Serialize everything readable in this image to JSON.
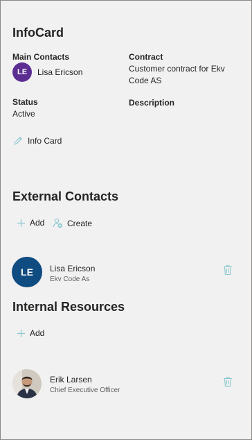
{
  "infocard": {
    "title": "InfoCard",
    "main_contacts_label": "Main Contacts",
    "main_contact": {
      "initials": "LE",
      "name": "Lisa Ericson"
    },
    "contract_label": "Contract",
    "contract_value": "Customer contract for Ekv Code AS",
    "status_label": "Status",
    "status_value": "Active",
    "description_label": "Description",
    "edit_link_label": "Info Card"
  },
  "external_contacts": {
    "title": "External Contacts",
    "add_label": "Add",
    "create_label": "Create",
    "items": [
      {
        "initials": "LE",
        "name": "Lisa Ericson",
        "company": "Ekv Code As"
      }
    ]
  },
  "internal_resources": {
    "title": "Internal Resources",
    "add_label": "Add",
    "items": [
      {
        "name": "Erik Larsen",
        "role": "Chief Executive Officer"
      }
    ]
  },
  "colors": {
    "avatar_purple": "#5c2e91",
    "avatar_blue": "#0f4c81",
    "icon_teal": "#8ac7cf",
    "panel_bg": "#f1f1f1"
  }
}
